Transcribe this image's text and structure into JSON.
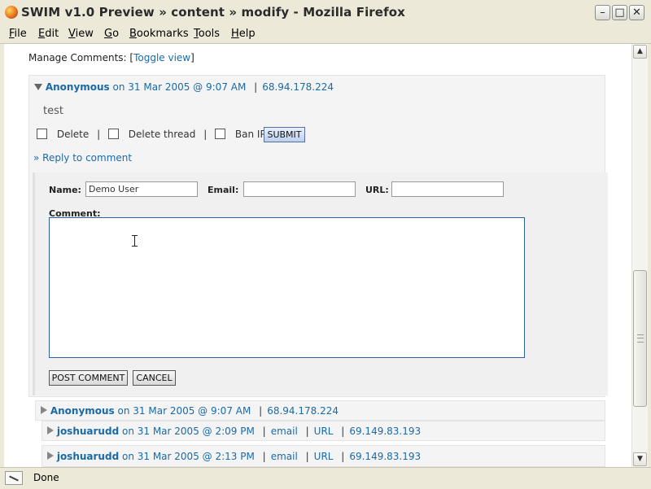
{
  "window": {
    "title": "SWIM v1.0 Preview » content » modify - Mozilla Firefox",
    "buttons": {
      "minimize": "–",
      "maximize": "□",
      "close": "✕"
    }
  },
  "menu": {
    "items": [
      {
        "ul": "F",
        "rest": "ile"
      },
      {
        "ul": "E",
        "rest": "dit"
      },
      {
        "ul": "V",
        "rest": "iew"
      },
      {
        "ul": "G",
        "rest": "o"
      },
      {
        "ul": "B",
        "rest": "ookmarks"
      },
      {
        "ul": "T",
        "rest": "ools"
      },
      {
        "ul": "H",
        "rest": "elp"
      }
    ]
  },
  "manage": {
    "label": "Manage Comments: [",
    "toggle": "Toggle view",
    "close_bracket": "]"
  },
  "comment": {
    "author": "Anonymous",
    "date": "on 31 Mar 2005 @ 9:07 AM",
    "sep": "|",
    "ip": "68.94.178.224",
    "body": "test",
    "delete_label": "Delete",
    "delete_thread_label": "Delete thread",
    "ban_ip_label": "Ban IP",
    "submit_label": "SUBMIT",
    "reply_link": "» Reply to comment"
  },
  "reply_form": {
    "name_label": "Name:",
    "name_value": "Demo User",
    "email_label": "Email:",
    "email_value": "",
    "url_label": "URL:",
    "url_value": "",
    "comment_label": "Comment:",
    "comment_value": "",
    "post_label": "POST COMMENT",
    "cancel_label": "CANCEL"
  },
  "threads": [
    {
      "author": "Anonymous",
      "date": "on 31 Mar 2005 @ 9:07 AM",
      "ip": "68.94.178.224"
    },
    {
      "author": "joshuarudd",
      "date": "on 31 Mar 2005 @ 2:09 PM",
      "email": "email",
      "url": "URL",
      "ip": "69.149.83.193"
    },
    {
      "author": "joshuarudd",
      "date": "on 31 Mar 2005 @ 2:13 PM",
      "email": "email",
      "url": "URL",
      "ip": "69.149.83.193"
    }
  ],
  "status": {
    "text": "Done"
  },
  "colors": {
    "link": "#1a6aa8",
    "window_bg": "#ece9d8",
    "form_bg": "#f0f0f0",
    "textarea_border": "#2d5fa6"
  }
}
